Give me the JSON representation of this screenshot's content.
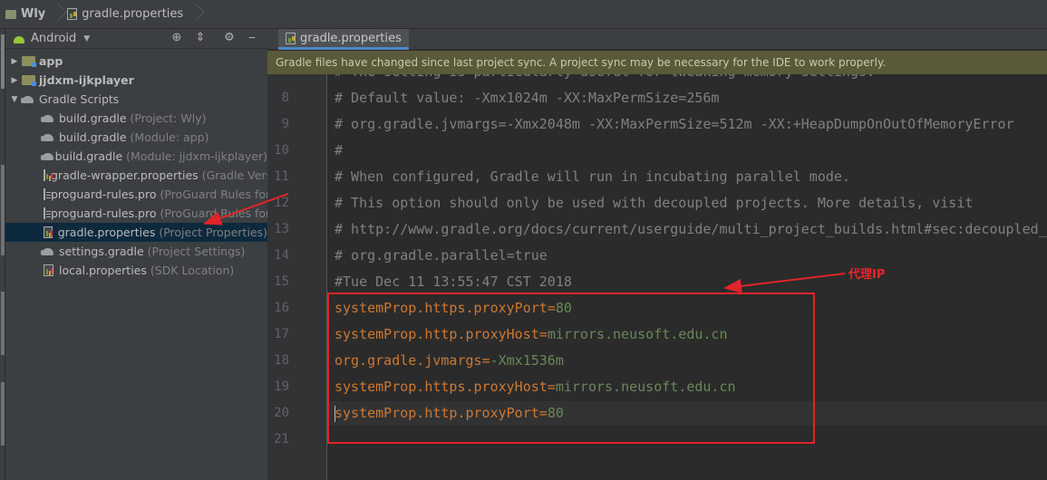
{
  "breadcrumb": {
    "project": "Wly",
    "file": "gradle.properties"
  },
  "project_panel": {
    "view_mode": "Android",
    "tree": [
      {
        "label": "app",
        "hint": "",
        "type": "module"
      },
      {
        "label": "jjdxm-ijkplayer",
        "hint": "",
        "type": "module"
      },
      {
        "label": "Gradle Scripts",
        "hint": "",
        "type": "group"
      },
      {
        "label": "build.gradle",
        "hint": "(Project: Wly)",
        "type": "gradle"
      },
      {
        "label": "build.gradle",
        "hint": "(Module: app)",
        "type": "gradle"
      },
      {
        "label": "build.gradle",
        "hint": "(Module: jjdxm-ijkplayer)",
        "type": "gradle"
      },
      {
        "label": "gradle-wrapper.properties",
        "hint": "(Gradle Vers",
        "type": "properties"
      },
      {
        "label": "proguard-rules.pro",
        "hint": "(ProGuard Rules for",
        "type": "pro"
      },
      {
        "label": "proguard-rules.pro",
        "hint": "(ProGuard Rules for",
        "type": "pro"
      },
      {
        "label": "gradle.properties",
        "hint": "(Project Properties)",
        "type": "properties"
      },
      {
        "label": "settings.gradle",
        "hint": "(Project Settings)",
        "type": "gradle"
      },
      {
        "label": "local.properties",
        "hint": "(SDK Location)",
        "type": "properties"
      }
    ]
  },
  "editor": {
    "tab_label": "gradle.properties",
    "notification": "Gradle files have changed since last project sync. A project sync may be necessary for the IDE to work properly.",
    "lines": [
      {
        "no": "",
        "kind": "comment",
        "text": "# The setting is particularly useful for tweaking memory settings."
      },
      {
        "no": "8",
        "kind": "comment",
        "text": "# Default value: -Xmx1024m -XX:MaxPermSize=256m"
      },
      {
        "no": "9",
        "kind": "comment",
        "text": "# org.gradle.jvmargs=-Xmx2048m -XX:MaxPermSize=512m -XX:+HeapDumpOnOutOfMemoryError"
      },
      {
        "no": "10",
        "kind": "comment",
        "text": "#"
      },
      {
        "no": "11",
        "kind": "comment",
        "text": "# When configured, Gradle will run in incubating parallel mode."
      },
      {
        "no": "12",
        "kind": "comment",
        "text": "# This option should only be used with decoupled projects. More details, visit"
      },
      {
        "no": "13",
        "kind": "comment",
        "text": "# http://www.gradle.org/docs/current/userguide/multi_project_builds.html#sec:decoupled_projects"
      },
      {
        "no": "14",
        "kind": "comment",
        "text": "# org.gradle.parallel=true"
      },
      {
        "no": "15",
        "kind": "comment",
        "text": "#Tue Dec 11 13:55:47 CST 2018"
      },
      {
        "no": "16",
        "kind": "prop",
        "key": "systemProp.https.proxyPort",
        "value": "80"
      },
      {
        "no": "17",
        "kind": "prop",
        "key": "systemProp.http.proxyHost",
        "value": "mirrors.neusoft.edu.cn"
      },
      {
        "no": "18",
        "kind": "prop",
        "key": "org.gradle.jvmargs",
        "value": "-Xmx1536m"
      },
      {
        "no": "19",
        "kind": "prop",
        "key": "systemProp.https.proxyHost",
        "value": "mirrors.neusoft.edu.cn"
      },
      {
        "no": "20",
        "kind": "prop",
        "key": "systemProp.http.proxyPort",
        "value": "80"
      },
      {
        "no": "21",
        "kind": "empty",
        "text": ""
      }
    ]
  },
  "annotation": {
    "label": "代理IP",
    "color": "#e0242a"
  }
}
